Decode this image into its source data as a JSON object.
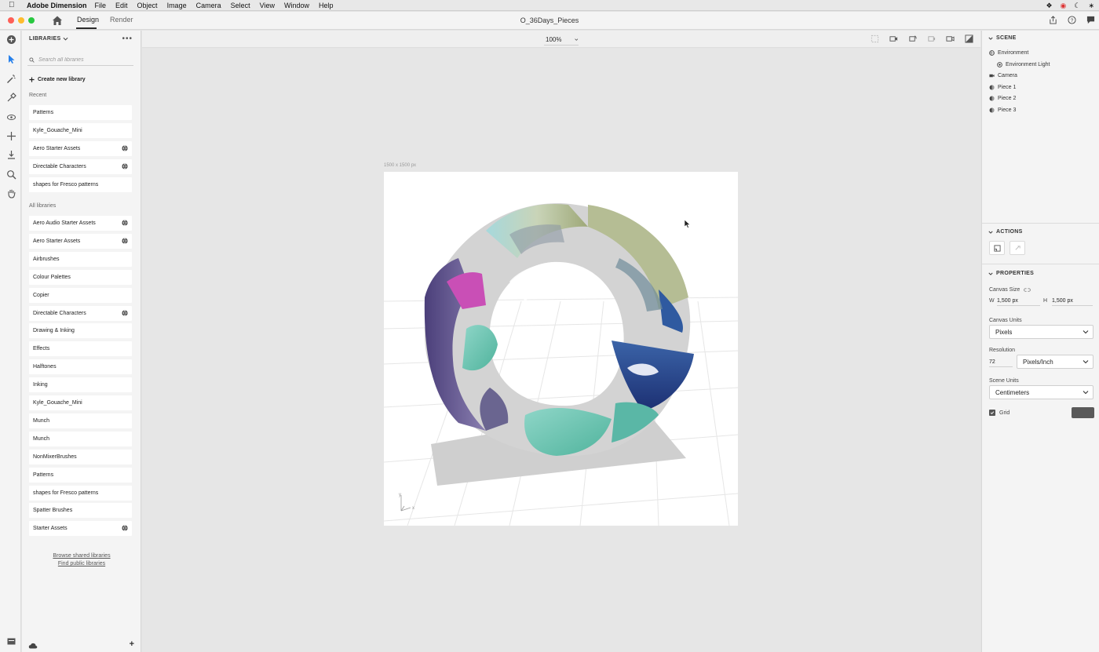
{
  "menubar": {
    "app_name": "Adobe Dimension",
    "items": [
      "File",
      "Edit",
      "Object",
      "Image",
      "Camera",
      "Select",
      "View",
      "Window",
      "Help"
    ]
  },
  "titlebar": {
    "tabs": [
      {
        "label": "Design",
        "active": true
      },
      {
        "label": "Render",
        "active": false
      }
    ],
    "doc_title": "O_36Days_Pieces"
  },
  "libraries": {
    "header": "LIBRARIES",
    "search_placeholder": "Search all libraries",
    "create_label": "Create new library",
    "recent_label": "Recent",
    "recent": [
      {
        "label": "Patterns",
        "shared": false
      },
      {
        "label": "Kyle_Gouache_Mini",
        "shared": false
      },
      {
        "label": "Aero Starter Assets",
        "shared": true
      },
      {
        "label": "Directable Characters",
        "shared": true
      },
      {
        "label": "shapes for Fresco patterns",
        "shared": false
      }
    ],
    "all_label": "All libraries",
    "all": [
      {
        "label": "Aero Audio Starter Assets",
        "shared": true
      },
      {
        "label": "Aero Starter Assets",
        "shared": true
      },
      {
        "label": "Airbrushes",
        "shared": false
      },
      {
        "label": "Colour Palettes",
        "shared": false
      },
      {
        "label": "Copier",
        "shared": false
      },
      {
        "label": "Directable Characters",
        "shared": true
      },
      {
        "label": "Drawing & Inking",
        "shared": false
      },
      {
        "label": "Effects",
        "shared": false
      },
      {
        "label": "Halftones",
        "shared": false
      },
      {
        "label": "Inking",
        "shared": false
      },
      {
        "label": "Kyle_Gouache_Mini",
        "shared": false
      },
      {
        "label": "Munch",
        "shared": false
      },
      {
        "label": "Munch",
        "shared": false
      },
      {
        "label": "NonMixerBrushes",
        "shared": false
      },
      {
        "label": "Patterns",
        "shared": false
      },
      {
        "label": "shapes for Fresco patterns",
        "shared": false
      },
      {
        "label": "Spatter Brushes",
        "shared": false
      },
      {
        "label": "Starter Assets",
        "shared": true
      }
    ],
    "browse_link": "Browse shared libraries",
    "public_link": "Find public libraries"
  },
  "canvas": {
    "zoom": "100%",
    "size_label": "1500 x 1500 px",
    "axis_x": "x",
    "axis_y": "y"
  },
  "scene": {
    "header": "SCENE",
    "items": [
      {
        "label": "Environment",
        "icon": "environment-icon",
        "indent": 0
      },
      {
        "label": "Environment Light",
        "icon": "light-icon",
        "indent": 1
      },
      {
        "label": "Camera",
        "icon": "camera-icon",
        "indent": 0
      },
      {
        "label": "Piece 1",
        "icon": "model-icon",
        "indent": 0
      },
      {
        "label": "Piece 2",
        "icon": "model-icon",
        "indent": 0
      },
      {
        "label": "Piece 3",
        "icon": "model-icon",
        "indent": 0
      }
    ]
  },
  "actions": {
    "header": "ACTIONS"
  },
  "properties": {
    "header": "PROPERTIES",
    "canvas_size_label": "Canvas Size",
    "w_label": "W",
    "w_value": "1,500 px",
    "h_label": "H",
    "h_value": "1,500 px",
    "units_label": "Canvas Units",
    "units_value": "Pixels",
    "resolution_label": "Resolution",
    "resolution_value": "72",
    "resolution_unit": "Pixels/Inch",
    "scene_units_label": "Scene Units",
    "scene_units_value": "Centimeters",
    "grid_label": "Grid",
    "grid_checked": true,
    "grid_color": "#5a5a5a"
  },
  "colors": {
    "accent": "#2680eb",
    "close": "#fe5f57",
    "minimize": "#febc2e",
    "maximize": "#28c840"
  }
}
